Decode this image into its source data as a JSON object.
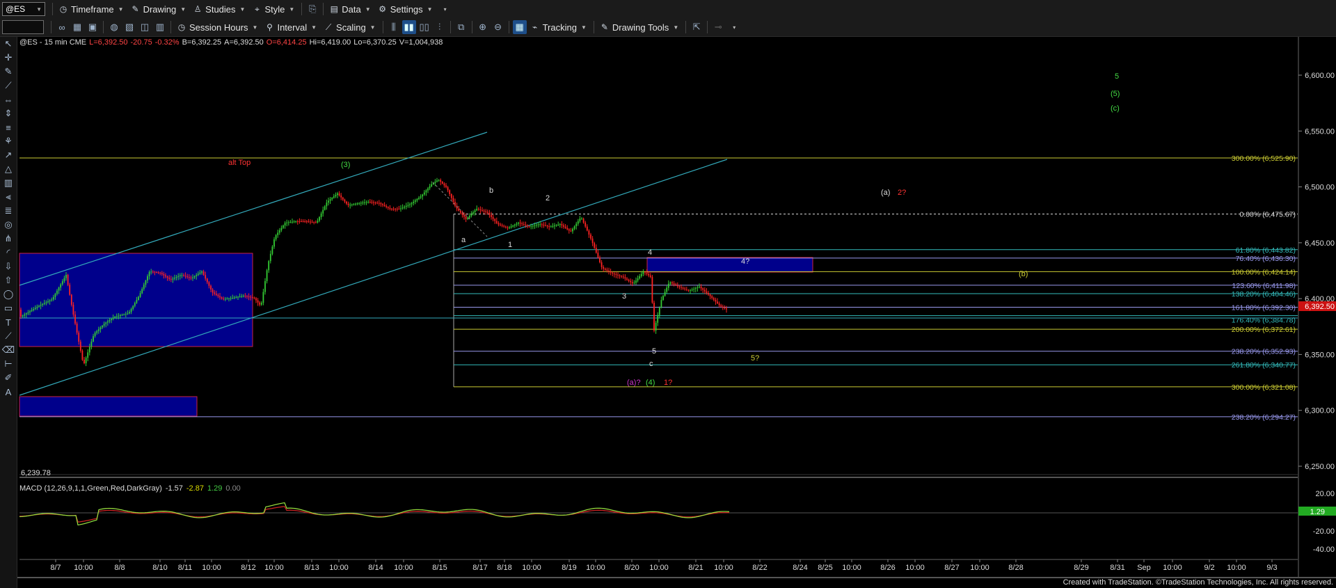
{
  "toolbar1": {
    "symbol": "@ES",
    "items": [
      {
        "label": "Timeframe",
        "icon": "clock-icon"
      },
      {
        "label": "Drawing",
        "icon": "pencil-icon"
      },
      {
        "label": "Studies",
        "icon": "studies-icon"
      },
      {
        "label": "Style",
        "icon": "style-icon"
      },
      {
        "label": "Data",
        "icon": "data-icon"
      },
      {
        "label": "Settings",
        "icon": "gear-icon"
      }
    ]
  },
  "toolbar2": {
    "items": [
      {
        "label": "Session Hours",
        "icon": "session-clock-icon"
      },
      {
        "label": "Interval",
        "icon": "interval-icon"
      },
      {
        "label": "Scaling",
        "icon": "scaling-icon"
      },
      {
        "label": "Tracking",
        "icon": "tracking-icon"
      },
      {
        "label": "Drawing Tools",
        "icon": "drawing-tools-icon"
      }
    ]
  },
  "info": {
    "symbol": "@ES - 15 min CME",
    "last": "L=6,392.50",
    "change": "-20.75",
    "pct": "-0.32%",
    "bid": "B=6,392.25",
    "ask": "A=6,392.50",
    "open": "O=6,414.25",
    "high": "Hi=6,419.00",
    "low": "Lo=6,370.25",
    "volume": "V=1,004,938"
  },
  "macd_info": {
    "name": "MACD (12,26,9,1,1,Green,Red,DarkGray)",
    "v1": "-1.57",
    "v2": "-2.87",
    "v3": "1.29",
    "v4": "0.00",
    "colors": [
      "#dddddd",
      "#dddd00",
      "#44cc44",
      "#888888"
    ]
  },
  "credit": "Created with TradeStation. ©TradeStation Technologies, Inc. All rights reserved.",
  "colors": {
    "background": "#000000",
    "up_candle": "#33cc33",
    "down_candle": "#ff2222",
    "channel": "#33aabb",
    "box_fill": "#00008b",
    "fib_yellow": "#cccc33",
    "fib_purple": "#9999ee",
    "fib_cyan": "#33bbbb"
  },
  "chart_data": {
    "type": "candlestick",
    "price_axis": {
      "labels": [
        "6,600.00",
        "6,550.00",
        "6,500.00",
        "6,450.00",
        "6,400.00",
        "6,350.00",
        "6,300.00",
        "6,250.00"
      ],
      "ylim": [
        6230,
        6635
      ]
    },
    "current_price_label": "6,392.50",
    "low_marker": "6,239.78",
    "date_axis": [
      "8/7",
      "10:00",
      "8/8",
      "8/10",
      "8/11",
      "10:00",
      "8/12",
      "10:00",
      "8/13",
      "10:00",
      "8/14",
      "10:00",
      "8/15",
      "8/17",
      "8/18",
      "10:00",
      "8/19",
      "10:00",
      "8/20",
      "10:00",
      "8/21",
      "10:00",
      "8/22",
      "8/24",
      "8/25",
      "10:00",
      "8/26",
      "10:00",
      "8/27",
      "10:00",
      "8/28",
      "8/29",
      "8/31",
      "Sep",
      "10:00",
      "9/2",
      "10:00",
      "9/3"
    ],
    "fib_levels": [
      {
        "label": "300.00% (6,525.90)",
        "price": 6525.9,
        "color": "#cccc33"
      },
      {
        "label": "0.00% (6,475.67)",
        "price": 6475.67,
        "color": "#dddddd"
      },
      {
        "label": "61.80% (6,443.82)",
        "price": 6443.82,
        "color": "#33bbbb"
      },
      {
        "label": "76.40% (6,436.30)",
        "price": 6436.3,
        "color": "#9999ee"
      },
      {
        "label": "100.00% (6,424.14)",
        "price": 6424.14,
        "color": "#cccc33"
      },
      {
        "label": "123.60% (6,411.98)",
        "price": 6411.98,
        "color": "#9999ee"
      },
      {
        "label": "138.20% (6,404.46)",
        "price": 6404.46,
        "color": "#33bbbb"
      },
      {
        "label": "161.80% (6,392.30)",
        "price": 6392.3,
        "color": "#9999ee"
      },
      {
        "label": "176.40% (6,384.78)",
        "price": 6384.78,
        "color": "#33bbbb"
      },
      {
        "label": "200.00% (6,372.61)",
        "price": 6372.61,
        "color": "#cccc33"
      },
      {
        "label": "238.20% (6,352.93)",
        "price": 6352.93,
        "color": "#9999ee"
      },
      {
        "label": "261.80% (6,340.77)",
        "price": 6340.77,
        "color": "#33bbbb"
      },
      {
        "label": "300.00% (6,321.08)",
        "price": 6321.08,
        "color": "#cccc33"
      },
      {
        "label": "238.20% (6,294.27)",
        "price": 6294.27,
        "color": "#9999ee"
      }
    ],
    "annotations": [
      "alt Top",
      "(3)",
      "a",
      "b",
      "1",
      "2",
      "4",
      "4?",
      "3",
      "5",
      "c",
      "(a)?",
      "(4)",
      "1?",
      "5?",
      "(a)",
      "2?",
      "(b)",
      "5",
      "(5)",
      "(c)"
    ],
    "macd_axis": [
      "20.00",
      "1.29",
      "-20.00",
      "-40.00"
    ]
  }
}
